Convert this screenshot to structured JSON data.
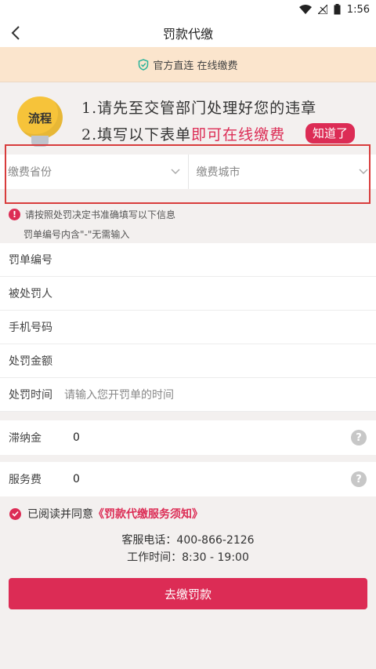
{
  "status_bar": {
    "time": "1:56",
    "icons": [
      "wifi-icon",
      "signal-icon",
      "battery-icon"
    ]
  },
  "header": {
    "title": "罚款代缴",
    "back_icon": "chevron-left-icon"
  },
  "notice": {
    "text": "官方直连 在线缴费",
    "icon": "shield-check-icon"
  },
  "process": {
    "bulb_label": "流程",
    "step1": "1.请先至交管部门处理好您的违章",
    "step2_prefix": "2.填写以下表单",
    "step2_highlight": "即可在线缴费",
    "dismiss_label": "知道了"
  },
  "region": {
    "province_placeholder": "缴费省份",
    "city_placeholder": "缴费城市"
  },
  "tips": {
    "line1": "请按照处罚决定书准确填写以下信息",
    "line2": "罚单编号内含\"-\"无需输入"
  },
  "form": {
    "fields": [
      {
        "label": "罚单编号",
        "value": ""
      },
      {
        "label": "被处罚人",
        "value": ""
      },
      {
        "label": "手机号码",
        "value": ""
      },
      {
        "label": "处罚金额",
        "value": ""
      },
      {
        "label": "处罚时间",
        "value": "请输入您开罚单的时间"
      }
    ]
  },
  "fees": {
    "late_fee": {
      "label": "滞纳金",
      "value": "0"
    },
    "service_fee": {
      "label": "服务费",
      "value": "0"
    }
  },
  "agreement": {
    "prefix": "已阅读并同意",
    "link": "《罚款代缴服务须知》"
  },
  "contact": {
    "phone": "客服电话：400-866-2126",
    "hours": "工作时间：8:30 - 19:00"
  },
  "actions": {
    "pay_label": "去缴罚款"
  },
  "colors": {
    "accent": "#dc2c55",
    "notice_bg": "#fbe5cd",
    "bulb": "#f6c33a",
    "highlight_border": "#d83c3c"
  }
}
